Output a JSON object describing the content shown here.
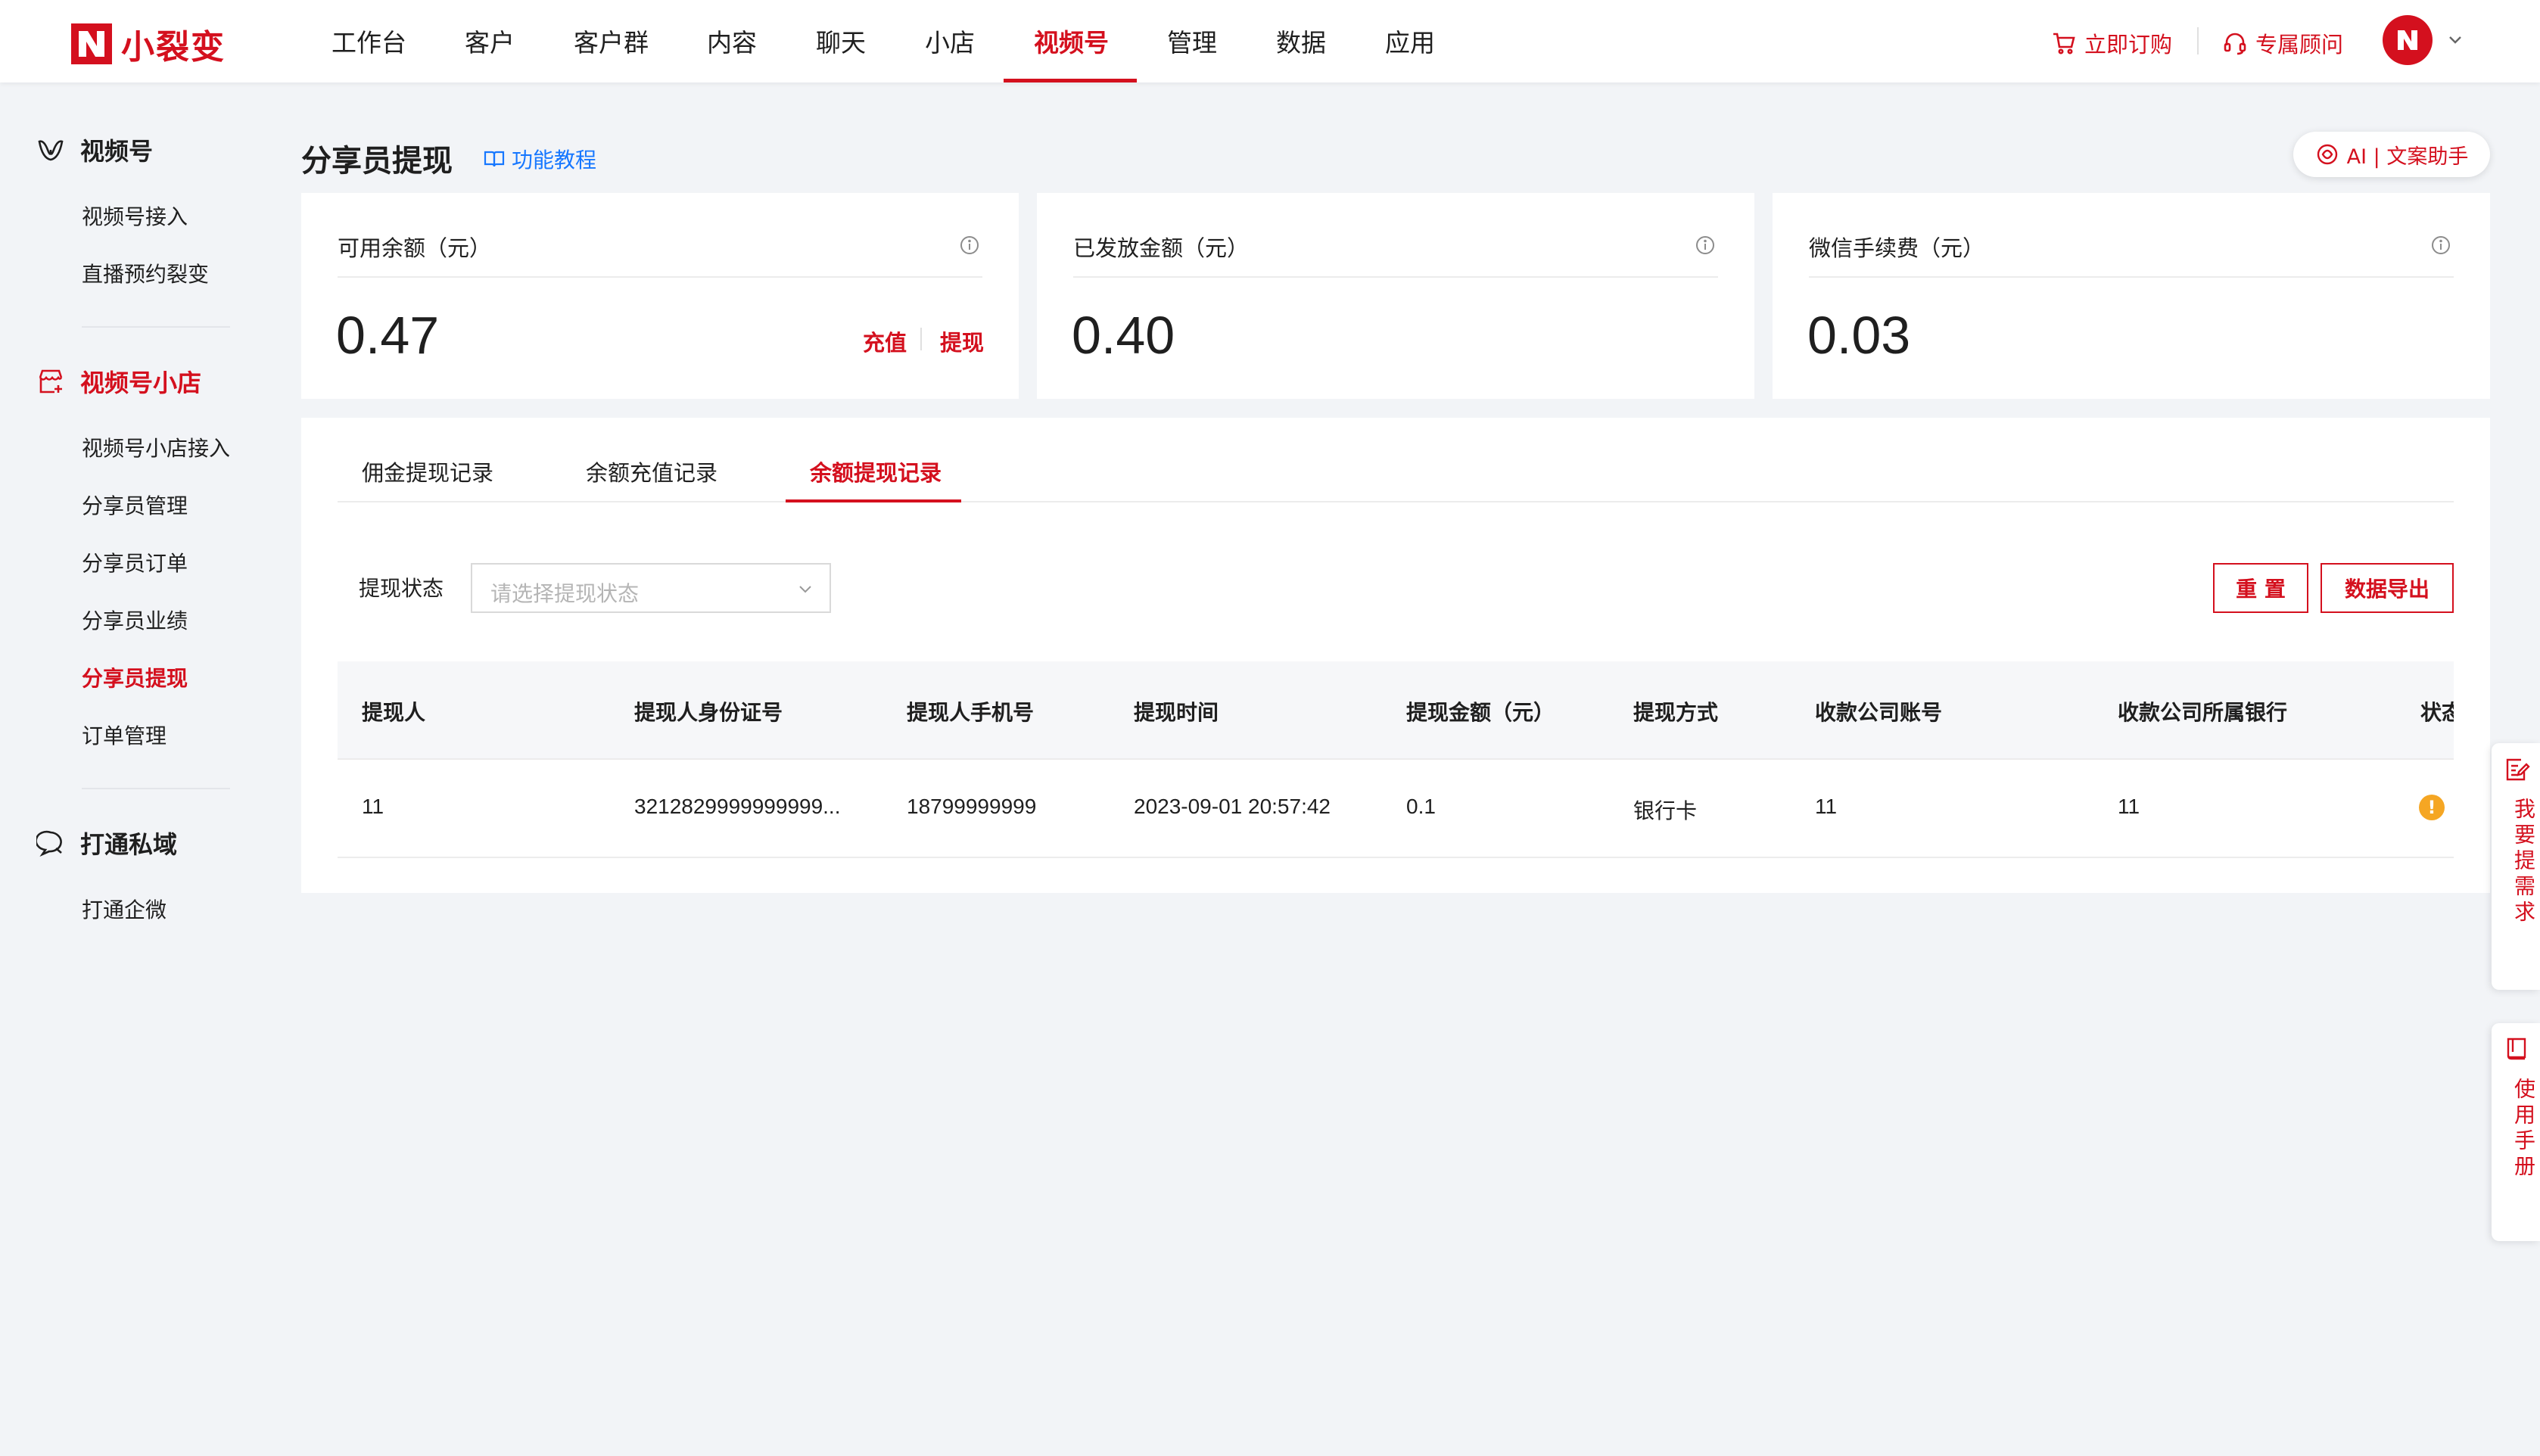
{
  "brand": {
    "name": "小裂变",
    "accent": "#d4101e",
    "link_color": "#1677ff"
  },
  "topnav": {
    "items": [
      {
        "label": "工作台"
      },
      {
        "label": "客户"
      },
      {
        "label": "客户群"
      },
      {
        "label": "内容"
      },
      {
        "label": "聊天"
      },
      {
        "label": "小店"
      },
      {
        "label": "视频号"
      },
      {
        "label": "管理"
      },
      {
        "label": "数据"
      },
      {
        "label": "应用"
      }
    ],
    "active": "视频号",
    "order_label": "立即订购",
    "advisor_label": "专属顾问"
  },
  "sidebar": {
    "groups": [
      {
        "label": "视频号",
        "icon": "video-channel-icon",
        "items": [
          {
            "label": "视频号接入"
          },
          {
            "label": "直播预约裂变"
          }
        ]
      },
      {
        "label": "视频号小店",
        "icon": "shop-icon",
        "active": true,
        "items": [
          {
            "label": "视频号小店接入"
          },
          {
            "label": "分享员管理"
          },
          {
            "label": "分享员订单"
          },
          {
            "label": "分享员业绩"
          },
          {
            "label": "分享员提现"
          },
          {
            "label": "订单管理"
          }
        ]
      },
      {
        "label": "打通私域",
        "icon": "chat-bubble-icon",
        "items": [
          {
            "label": "打通企微"
          }
        ]
      }
    ],
    "active_item": "分享员提现"
  },
  "page": {
    "title": "分享员提现",
    "tutorial_label": "功能教程",
    "ai_label": "AI | 文案助手"
  },
  "cards": [
    {
      "label": "可用余额（元）",
      "value": "0.47",
      "actions": [
        "充值",
        "提现"
      ]
    },
    {
      "label": "已发放金额（元）",
      "value": "0.40"
    },
    {
      "label": "微信手续费（元）",
      "value": "0.03"
    }
  ],
  "records": {
    "tabs": [
      {
        "label": "佣金提现记录"
      },
      {
        "label": "余额充值记录"
      },
      {
        "label": "余额提现记录"
      }
    ],
    "active_tab": "余额提现记录",
    "filter": {
      "label": "提现状态",
      "placeholder": "请选择提现状态"
    },
    "reset_label": "重 置",
    "export_label": "数据导出",
    "columns": [
      "提现人",
      "提现人身份证号",
      "提现人手机号",
      "提现时间",
      "提现金额（元）",
      "提现方式",
      "收款公司账号",
      "收款公司所属银行",
      "状态"
    ],
    "rows": [
      {
        "name": "11",
        "id_number": "3212829999999999...",
        "phone": "18799999999",
        "time": "2023-09-01 20:57:42",
        "amount": "0.1",
        "method": "银行卡",
        "account": "11",
        "bank": "11",
        "status_icon": "warning-icon"
      }
    ]
  },
  "float_tabs": [
    {
      "label": "我要提需求",
      "icon": "edit-note-icon"
    },
    {
      "label": "使用手册",
      "icon": "book-icon"
    }
  ]
}
